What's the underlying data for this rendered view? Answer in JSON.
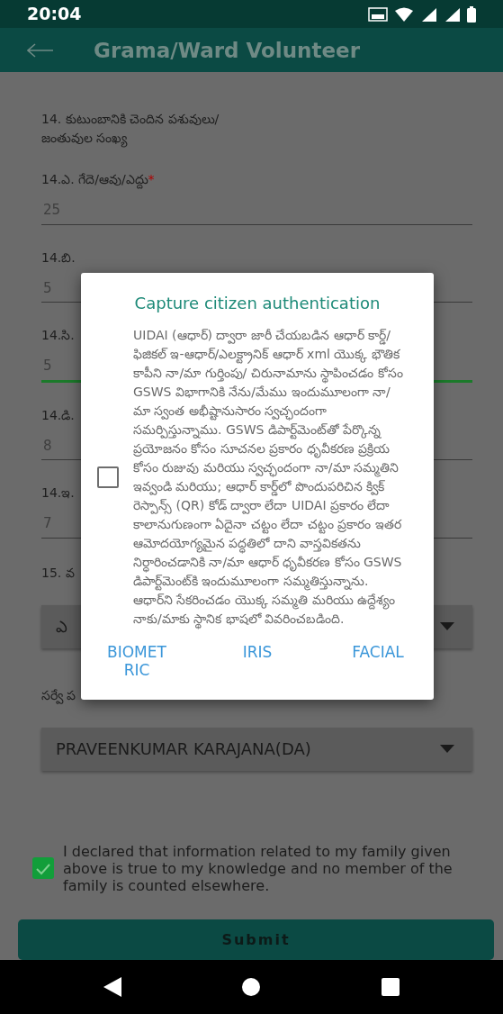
{
  "status_bar": {
    "time": "20:04"
  },
  "app_bar": {
    "title": "Grama/Ward Volunteer"
  },
  "form": {
    "items": [
      {
        "kind": "heading",
        "label": "14. కుటుంబానికి చెందిన పశువులు/ జంతువుల సంఖ్య"
      },
      {
        "kind": "text",
        "label": "14.ఎ. గేదె/ఆవు/ఎద్దు",
        "required_mark": "*",
        "value": "25",
        "focused": false
      },
      {
        "kind": "text",
        "label": "14.బి.",
        "value": "5",
        "focused": false
      },
      {
        "kind": "text",
        "label": "14.సి.",
        "value": "5",
        "focused": true
      },
      {
        "kind": "text",
        "label": "14.డి.",
        "value": "8",
        "focused": false
      },
      {
        "kind": "text",
        "label": "14.ఇ.",
        "value": "7",
        "focused": false
      },
      {
        "kind": "heading",
        "label": "15. వ"
      },
      {
        "kind": "dropdown",
        "value": "ఎ"
      },
      {
        "kind": "heading",
        "label": "సర్వే ప"
      },
      {
        "kind": "dropdown",
        "value": "PRAVEENKUMAR KARAJANA(DA)"
      }
    ]
  },
  "declaration": {
    "checked": true,
    "text": "I declared that information related to my family given above is true to my knowledge and no member of the family is counted elsewhere."
  },
  "submit": {
    "label": "Submit"
  },
  "dialog": {
    "title": "Capture citizen authentication",
    "consent": {
      "checked": false,
      "text": "UIDAI (ఆధార్) ద్వారా జారీ చేయబడిన ఆధార్ కార్డ్/ఫిజికల్ ఇ-ఆధార్/ఎలక్ట్రానిక్ ఆధార్ xml యొక్క భౌతిక కాపీని నా/మా గుర్తింపు/ చిరునామాను స్థాపించడం కోసం GSWS విభాగానికి నేను/మేము ఇందుమూలంగా నా/మా స్వంత అభీష్టానుసారం స్వచ్ఛందంగా సమర్పిస్తున్నాము. GSWS డిపార్ట్‌మెంట్‌తో పేర్కొన్న ప్రయోజనం కోసం సూచనల ప్రకారం ధృవీకరణ ప్రక్రియ కోసం రుజువు మరియు స్వచ్ఛందంగా నా/మా సమ్మతిని ఇవ్వండి మరియు; ఆధార్ కార్డ్‌లో పొందుపరిచిన క్విక్ రెస్పాన్స్ (QR) కోడ్ ద్వారా లేదా UIDAI ప్రకారం లేదా కాలానుగుణంగా ఏదైనా చట్టం లేదా చట్టం ప్రకారం ఇతర ఆమోదయోగ్యమైన పద్ధతిలో దాని వాస్తవికతను నిర్ధారించడానికి నా/మా ఆధార్ ధృవీకరణ కోసం GSWS డిపార్ట్‌మెంట్‌కి ఇందుమూలంగా సమ్మతిస్తున్నాను. ఆధార్‌ని సేకరించడం యొక్క సమ్మతి మరియు ఉద్దేశ్యం నాకు/మాకు స్థానిక భాషలో వివరించబడింది."
    },
    "buttons": [
      "BIOMET RIC",
      "IRIS",
      "FACIAL"
    ]
  }
}
